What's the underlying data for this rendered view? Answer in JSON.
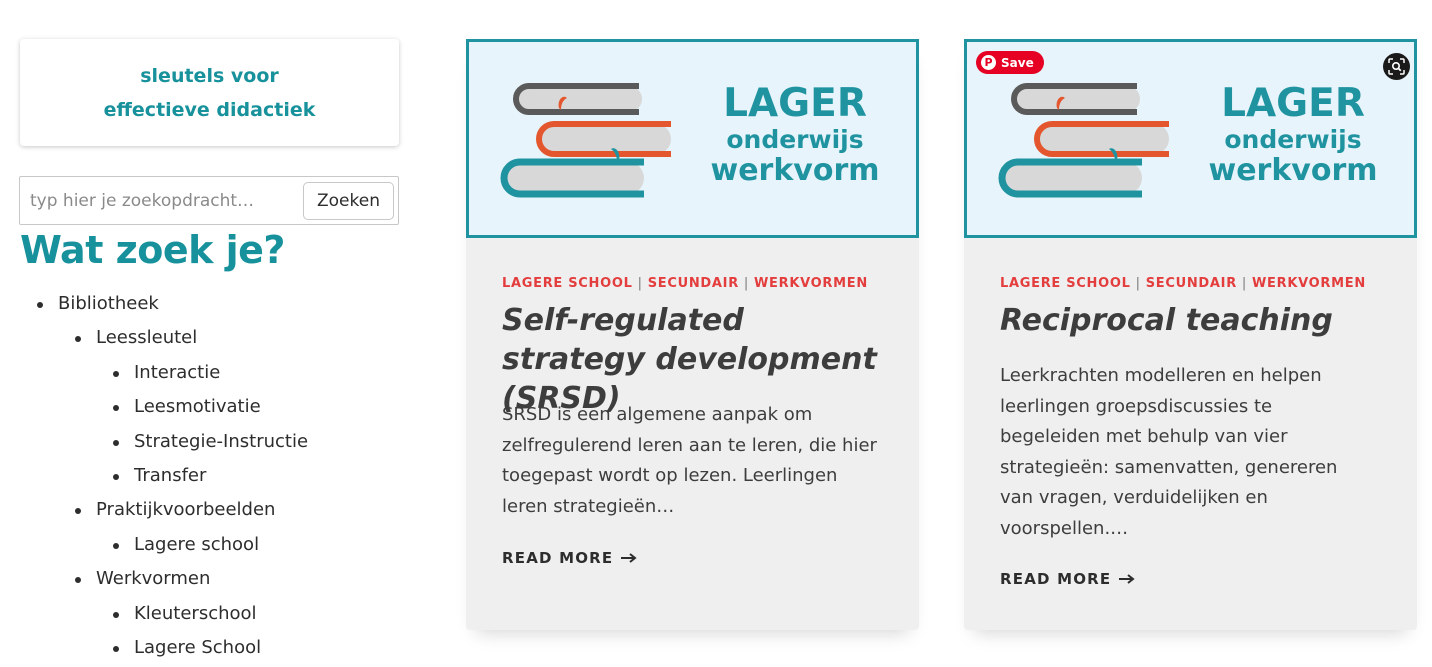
{
  "sidebar": {
    "cta": {
      "text": "sleutels voor effectieve didactiek"
    },
    "search": {
      "placeholder": "typ hier je zoekopdracht…",
      "button_label": "Zoeken"
    },
    "widget_title": "Wat zoek je?",
    "nav": [
      {
        "label": "Bibliotheek",
        "level": 1
      },
      {
        "label": "Leessleutel",
        "level": 2
      },
      {
        "label": "Interactie",
        "level": 3
      },
      {
        "label": "Leesmotivatie",
        "level": 3
      },
      {
        "label": "Strategie-Instructie",
        "level": 3
      },
      {
        "label": "Transfer",
        "level": 3
      },
      {
        "label": "Praktijkvoorbeelden",
        "level": 2
      },
      {
        "label": "Lagere school",
        "level": 3
      },
      {
        "label": "Werkvormen",
        "level": 2
      },
      {
        "label": "Kleuterschool",
        "level": 3
      },
      {
        "label": "Lagere School",
        "level": 3
      }
    ]
  },
  "cards": [
    {
      "image": {
        "line1": "LAGER",
        "line2": "onderwijs",
        "line3": "werkvorm"
      },
      "categories": [
        "LAGERE SCHOOL",
        "SECUNDAIR",
        "WERKVORMEN"
      ],
      "title": "Self-regulated strategy development (SRSD)",
      "excerpt": "SRSD is een algemene aanpak om zelfregulerend leren aan te leren, die hier toegepast wordt op lezen. Leerlingen leren strategieën…",
      "read_more": "READ MORE"
    },
    {
      "image": {
        "line1": "LAGER",
        "line2": "onderwijs",
        "line3": "werkvorm"
      },
      "pinterest_save": "Save",
      "categories": [
        "LAGERE SCHOOL",
        "SECUNDAIR",
        "WERKVORMEN"
      ],
      "title": "Reciprocal teaching",
      "excerpt": "Leerkrachten modelleren en helpen leerlingen groepsdiscussies te begeleiden met behulp van vier strategieën: samenvatten, genereren van vragen, verduidelijken en voorspellen.…",
      "read_more": "READ MORE"
    }
  ],
  "colors": {
    "accent": "#17919b",
    "category": "#e43d3d",
    "card_bg": "#efefef",
    "pinterest": "#e60023"
  },
  "icons": {
    "read_more_arrow": "arrow-right-icon",
    "lens": "visual-search-icon",
    "pinterest": "pinterest-icon"
  }
}
